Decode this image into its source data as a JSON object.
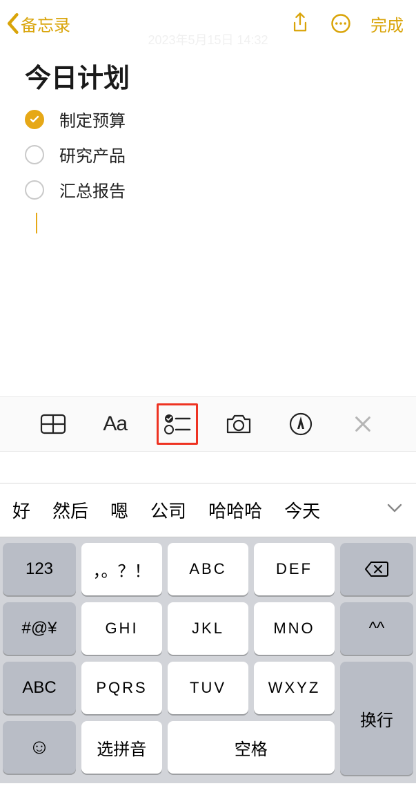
{
  "nav": {
    "back_label": "备忘录",
    "timestamp": "2023年5月15日 14:32",
    "done_label": "完成"
  },
  "note": {
    "title": "今日计划",
    "items": [
      {
        "text": "制定预算",
        "checked": true
      },
      {
        "text": "研究产品",
        "checked": false
      },
      {
        "text": "汇总报告",
        "checked": false
      }
    ]
  },
  "toolbar": {
    "format_label": "Aa"
  },
  "candidates": [
    "好",
    "然后",
    "嗯",
    "公司",
    "哈哈哈",
    "今天"
  ],
  "keys": {
    "r1": {
      "side_l": "123",
      "m1": "，。？！",
      "m2": "ABC",
      "m3": "DEF"
    },
    "r2": {
      "side_l": "#@¥",
      "m1": "GHI",
      "m2": "JKL",
      "m3": "MNO",
      "side_r": "^^"
    },
    "r3": {
      "side_l": "ABC",
      "m1": "PQRS",
      "m2": "TUV",
      "m3": "WXYZ"
    },
    "r4": {
      "pinyin": "选拼音",
      "space": "空格",
      "enter": "换行"
    }
  }
}
